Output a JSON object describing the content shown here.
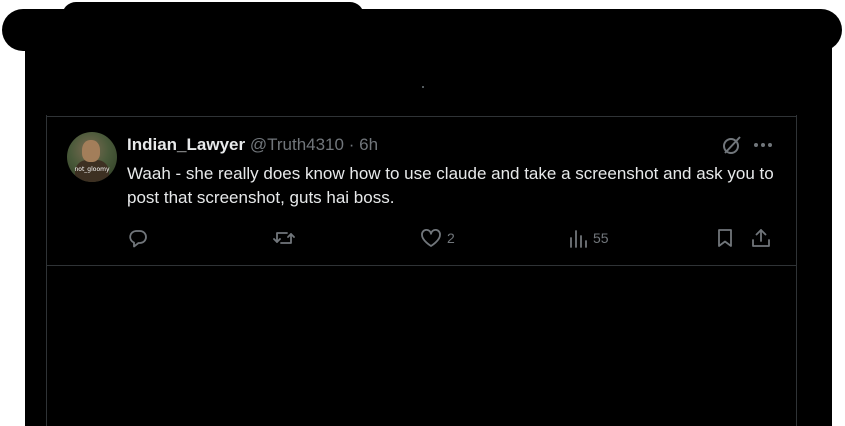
{
  "tweet": {
    "display_name": "Indian_Lawyer",
    "handle": "@Truth4310",
    "separator": "·",
    "time": "6h",
    "text": "Waah - she really does know how to use claude and take a screenshot and ask you to post that screenshot, guts hai boss.",
    "avatar_caption": "not_gloomy",
    "icons": {
      "grok": "grok-icon",
      "more": "more-icon"
    },
    "actions": {
      "reply": {
        "icon": "reply-icon"
      },
      "repost": {
        "icon": "repost-icon"
      },
      "like": {
        "icon": "heart-icon",
        "count": "2"
      },
      "views": {
        "icon": "views-icon",
        "count": "55"
      },
      "bookmark": {
        "icon": "bookmark-icon"
      },
      "share": {
        "icon": "share-icon"
      }
    }
  },
  "colors": {
    "background": "#000000",
    "text_primary": "#e7e9ea",
    "text_secondary": "#71767b",
    "border": "#2f3336"
  }
}
